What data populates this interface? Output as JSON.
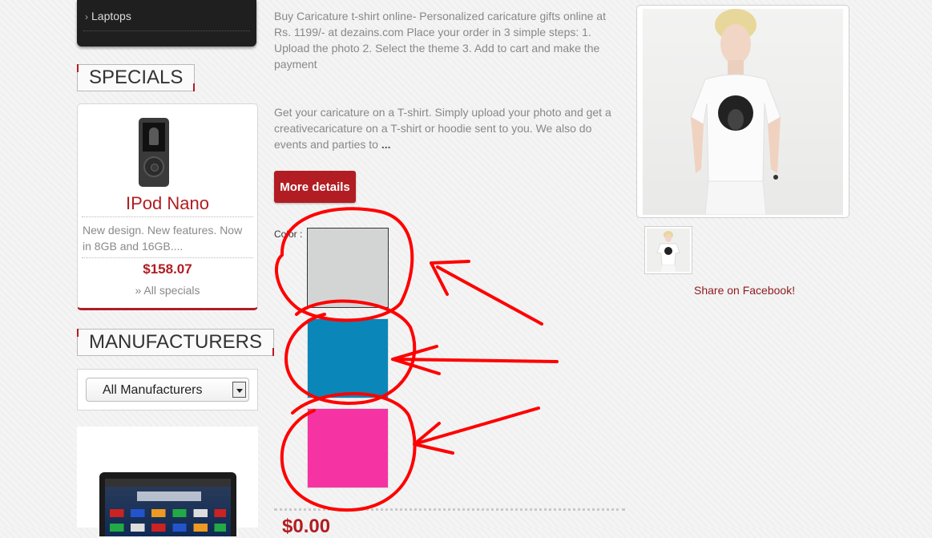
{
  "sidebar": {
    "categories": {
      "last_item": "Laptops"
    },
    "specials": {
      "title": "SPECIALS",
      "product_name": "IPod Nano",
      "description": "New design. New features. Now in 8GB and 16GB....",
      "price": "$158.07",
      "all_link": "» All specials"
    },
    "manufacturers": {
      "title": "MANUFACTURERS",
      "selected": "All Manufacturers"
    }
  },
  "product": {
    "short_description": "Buy Caricature t-shirt online- Personalized caricature gifts online at Rs. 1199/- at dezains.com Place your order in 3 simple steps: 1. Upload the photo 2. Select the theme 3. Add to cart and make the payment",
    "long_description": "Get your caricature on a T-shirt. Simply upload your photo and get a creativecaricature on a T-shirt or hoodie sent to you. We also do events and parties to",
    "ellipsis": "...",
    "more_details_label": "More details",
    "color_label": "Color :",
    "colors": [
      "#d3d5d5",
      "#0a86b8",
      "#f533a3"
    ],
    "price": "$0.00",
    "share_label": "Share on Facebook!"
  },
  "theme": {
    "accent": "#b11d22",
    "annotation": "#ff0000"
  }
}
